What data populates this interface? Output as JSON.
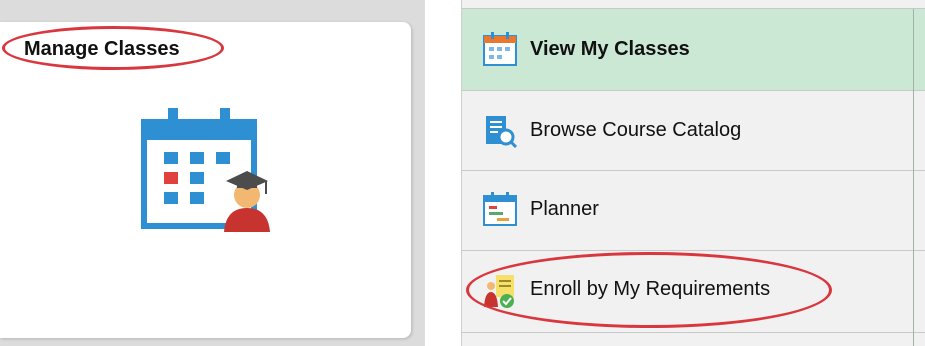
{
  "tile": {
    "title": "Manage Classes",
    "icon": "calendar-graduate-icon"
  },
  "nav": {
    "items": [
      {
        "label": "View My Classes",
        "icon": "calendar-icon",
        "selected": true
      },
      {
        "label": "Browse Course Catalog",
        "icon": "catalog-search-icon",
        "selected": false
      },
      {
        "label": "Planner",
        "icon": "planner-icon",
        "selected": false
      },
      {
        "label": "Enroll by My Requirements",
        "icon": "requirements-icon",
        "selected": false
      }
    ]
  },
  "colors": {
    "highlight_oval": "#d9363e",
    "selected_bg": "#cbe8d4",
    "calendar_blue": "#2f8fd3"
  }
}
